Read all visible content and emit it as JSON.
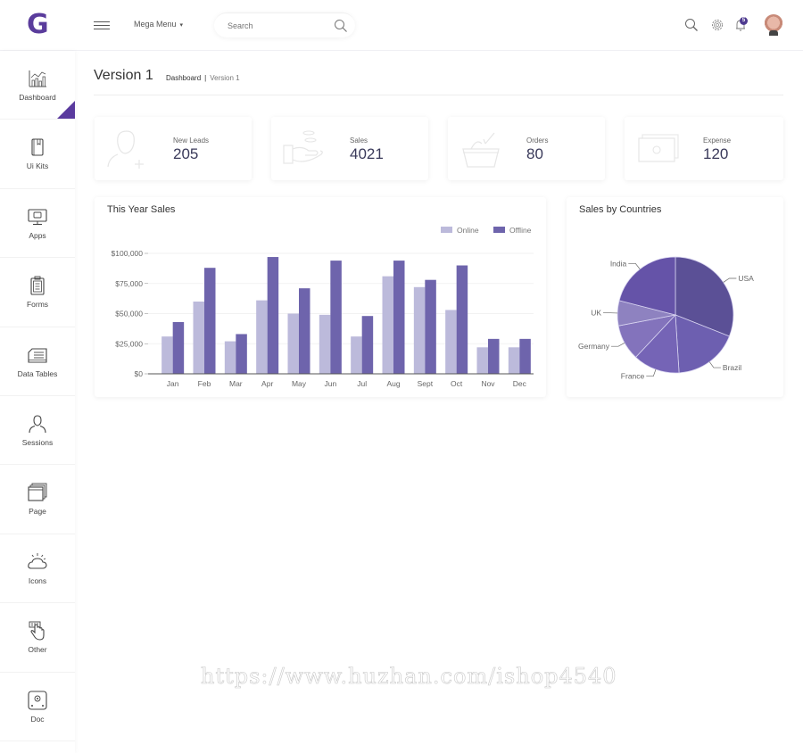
{
  "header": {
    "logo": "G",
    "mega_menu_label": "Mega Menu",
    "mega_menu_caret": "▾",
    "search_placeholder": "Search",
    "notification_count": "5",
    "icons": [
      "menu-icon",
      "search-icon",
      "gear-icon",
      "bell-icon",
      "avatar"
    ]
  },
  "sidebar": {
    "items": [
      {
        "label": "Dashboard",
        "icon": "chart-icon",
        "active": true
      },
      {
        "label": "Ui Kits",
        "icon": "book-icon"
      },
      {
        "label": "Apps",
        "icon": "monitor-icon"
      },
      {
        "label": "Forms",
        "icon": "clipboard-icon"
      },
      {
        "label": "Data Tables",
        "icon": "table-icon"
      },
      {
        "label": "Sessions",
        "icon": "user-icon"
      },
      {
        "label": "Page",
        "icon": "pages-icon"
      },
      {
        "label": "Icons",
        "icon": "cloud-sun-icon"
      },
      {
        "label": "Other",
        "icon": "hand-pointer-icon"
      },
      {
        "label": "Doc",
        "icon": "doc-icon"
      }
    ]
  },
  "page": {
    "title": "Version 1",
    "breadcrumb": [
      "Dashboard",
      "Version 1"
    ],
    "breadcrumb_sep": "|"
  },
  "stats": [
    {
      "label": "New Leads",
      "value": "205",
      "icon": "user-add-icon"
    },
    {
      "label": "Sales",
      "value": "4021",
      "icon": "hand-money-icon"
    },
    {
      "label": "Orders",
      "value": "80",
      "icon": "basket-icon"
    },
    {
      "label": "Expense",
      "value": "120",
      "icon": "cash-icon"
    }
  ],
  "colors": {
    "accent": "#5a3a9e",
    "online": "#bcbadb",
    "offline": "#6e64ac"
  },
  "chart_data": [
    {
      "type": "bar",
      "title": "This Year Sales",
      "categories": [
        "Jan",
        "Feb",
        "Mar",
        "Apr",
        "May",
        "Jun",
        "Jul",
        "Aug",
        "Sept",
        "Oct",
        "Nov",
        "Dec"
      ],
      "series": [
        {
          "name": "Online",
          "color": "#bcbadb",
          "values": [
            31000,
            60000,
            27000,
            61000,
            50000,
            49000,
            31000,
            81000,
            72000,
            53000,
            22000,
            22000
          ]
        },
        {
          "name": "Offline",
          "color": "#6e64ac",
          "values": [
            43000,
            88000,
            33000,
            97000,
            71000,
            94000,
            48000,
            94000,
            78000,
            90000,
            29000,
            29000
          ]
        }
      ],
      "yticks": [
        0,
        25000,
        50000,
        75000,
        100000
      ],
      "ytick_labels": [
        "$0",
        "$25,000",
        "$50,000",
        "$75,000",
        "$100,000"
      ],
      "ylim": [
        0,
        100000
      ],
      "xlabel": "",
      "ylabel": "",
      "legend": "top-right",
      "grid": true
    },
    {
      "type": "pie",
      "title": "Sales by Countries",
      "slices": [
        {
          "label": "USA",
          "value": 31,
          "color": "#5b5096"
        },
        {
          "label": "Brazil",
          "value": 18,
          "color": "#6d5fb0"
        },
        {
          "label": "France",
          "value": 13,
          "color": "#7564b6"
        },
        {
          "label": "Germany",
          "value": 10,
          "color": "#8373bc"
        },
        {
          "label": "UK",
          "value": 7,
          "color": "#8e82c0"
        },
        {
          "label": "India",
          "value": 21,
          "color": "#6553a8"
        }
      ]
    }
  ],
  "watermark": "https://www.huzhan.com/ishop4540"
}
